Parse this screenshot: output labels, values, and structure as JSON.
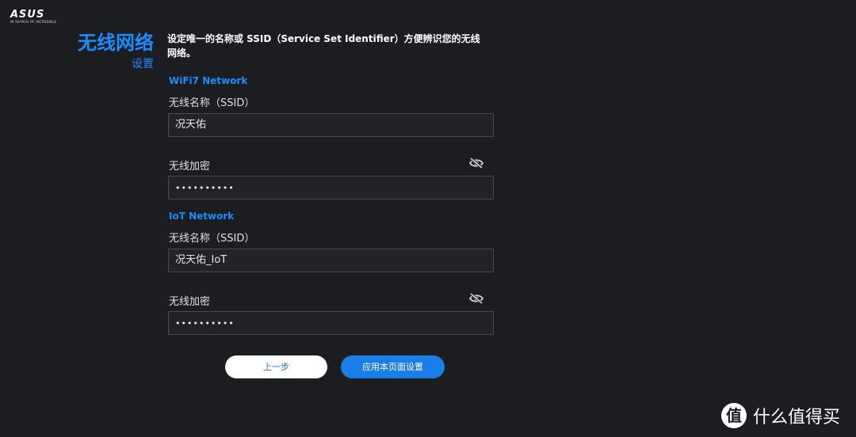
{
  "brand": {
    "logo_text": "ASUS",
    "tagline": "IN SEARCH OF INCREDIBLE"
  },
  "header": {
    "title": "无线网络",
    "subtitle": "设置",
    "description": "设定唯一的名称或 SSID（Service Set Identifier）方便辨识您的无线网络。"
  },
  "wifi7": {
    "heading": "WiFi7 Network",
    "ssid_label": "无线名称（SSID）",
    "ssid_value": "况天佑",
    "password_label": "无线加密",
    "password_value": "••••••••••"
  },
  "iot": {
    "heading": "IoT Network",
    "ssid_label": "无线名称（SSID）",
    "ssid_value": "况天佑_IoT",
    "password_label": "无线加密",
    "password_value": "••••••••••"
  },
  "actions": {
    "back_label": "上一步",
    "apply_label": "应用本页面设置"
  },
  "watermark": {
    "badge": "值",
    "text": "什么值得买"
  },
  "icons": {
    "eye": "eye-slash-icon"
  },
  "colors": {
    "accent": "#1a8cff",
    "background": "#1c1d20",
    "field_bg": "#222326"
  }
}
